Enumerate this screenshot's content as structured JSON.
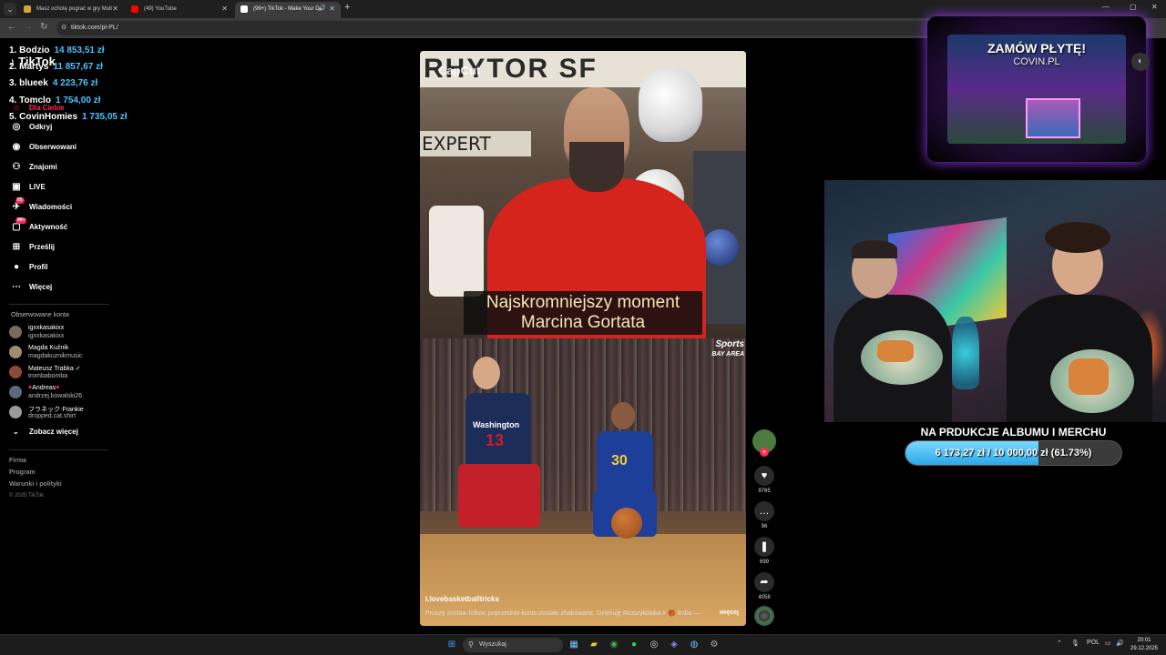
{
  "browser": {
    "tabs": [
      {
        "title": "Masz ochotę pograć w gry Mult",
        "favicon_color": "#d7a13a"
      },
      {
        "title": "(49) YouTube",
        "favicon_color": "#ff0000"
      },
      {
        "title": "(99+) TikTok - Make Your Da",
        "favicon_color": "#ffffff",
        "active": true
      }
    ],
    "url": "tiktok.com/pl-PL/"
  },
  "sidebar": {
    "logo": "TikTok",
    "nav": [
      {
        "label": "Dla Ciebie",
        "icon": "home-icon",
        "glyph": "⌂"
      },
      {
        "label": "Odkryj",
        "icon": "compass-icon",
        "glyph": "◎"
      },
      {
        "label": "Obserwowani",
        "icon": "following-icon",
        "glyph": "◉"
      },
      {
        "label": "Znajomi",
        "icon": "friends-icon",
        "glyph": "⚇"
      },
      {
        "label": "LIVE",
        "icon": "live-icon",
        "glyph": "▣"
      },
      {
        "label": "Wiadomości",
        "icon": "messages-icon",
        "glyph": "✈",
        "badge": "55"
      },
      {
        "label": "Aktywność",
        "icon": "activity-icon",
        "glyph": "▢",
        "badge": "99+"
      },
      {
        "label": "Prześlij",
        "icon": "upload-icon",
        "glyph": "⊞"
      },
      {
        "label": "Profil",
        "icon": "profile-icon",
        "glyph": "●"
      },
      {
        "label": "Więcej",
        "icon": "more-icon",
        "glyph": "⋯"
      }
    ],
    "following_title": "Obserwowane konta",
    "following": [
      {
        "name": "igxxkasakixx",
        "handle": "igxxkasakixx",
        "color": "#7a6a5a"
      },
      {
        "name": "Magda Kuźnik",
        "handle": "magdakuznikmusic",
        "color": "#a08a70"
      },
      {
        "name": "Mateusz Trabka",
        "handle": "trombabomba",
        "color": "#8a4a3a",
        "verified": true
      },
      {
        "name": "Andreas",
        "handle": "andrzej.kowalski26",
        "color": "#5a6a7a"
      },
      {
        "name": "フラネック·Frankie",
        "handle": "dropped.cat.shirt",
        "color": "#9a9a9a"
      }
    ],
    "see_more": "Zobacz więcej",
    "footer": [
      "Firma",
      "Program",
      "Warunki i polityki"
    ],
    "copyright": "© 2025 TikTok"
  },
  "leaderboard": [
    {
      "rank": "1.",
      "name": "Bodzio",
      "amount": "14 853,51 zł"
    },
    {
      "rank": "2.",
      "name": "Martys",
      "amount": "11 857,67 zł"
    },
    {
      "rank": "3.",
      "name": "blueek",
      "amount": "4 223,76 zł"
    },
    {
      "rank": "4.",
      "name": "Tomclo",
      "amount": "1 754,00 zł"
    },
    {
      "rank": "5.",
      "name": "CovinHomies",
      "amount": "1 735,05 zł"
    }
  ],
  "video": {
    "watermark": "CapCut",
    "banner_text": "RHYTOR SF",
    "expert_label": "EXPERT",
    "caption": "Najskromniejszy moment Marcina Gortata",
    "jersey_text": "Washington",
    "jersey_number_1": "13",
    "jersey_number_2": "30",
    "network_logo": "Sports",
    "network_sub": "BAY AREA",
    "author": "i.lovebasketballtricks",
    "description": "Proszę zostaw follow, poprzednie konto zostało zhakowane. Dziękuję #koszykówka # 🏀 #nba —",
    "more": "więcej"
  },
  "actions": {
    "likes": "9765",
    "comments": "96",
    "saves": "699",
    "shares": "4058"
  },
  "overlay": {
    "promo_title": "ZAMÓW PŁYTĘ!",
    "promo_sub": "COVIN.PL",
    "goal_title": "NA PRDUKCJE ALBUMU I MERCHU",
    "goal_text": "6 173,27 zł / 10 000,00 zł (61.73%)",
    "goal_fraction": 0.6173
  },
  "taskbar": {
    "search_placeholder": "Wyszukaj",
    "language": "POL",
    "time": "20:01",
    "date": "29.12.2025"
  }
}
